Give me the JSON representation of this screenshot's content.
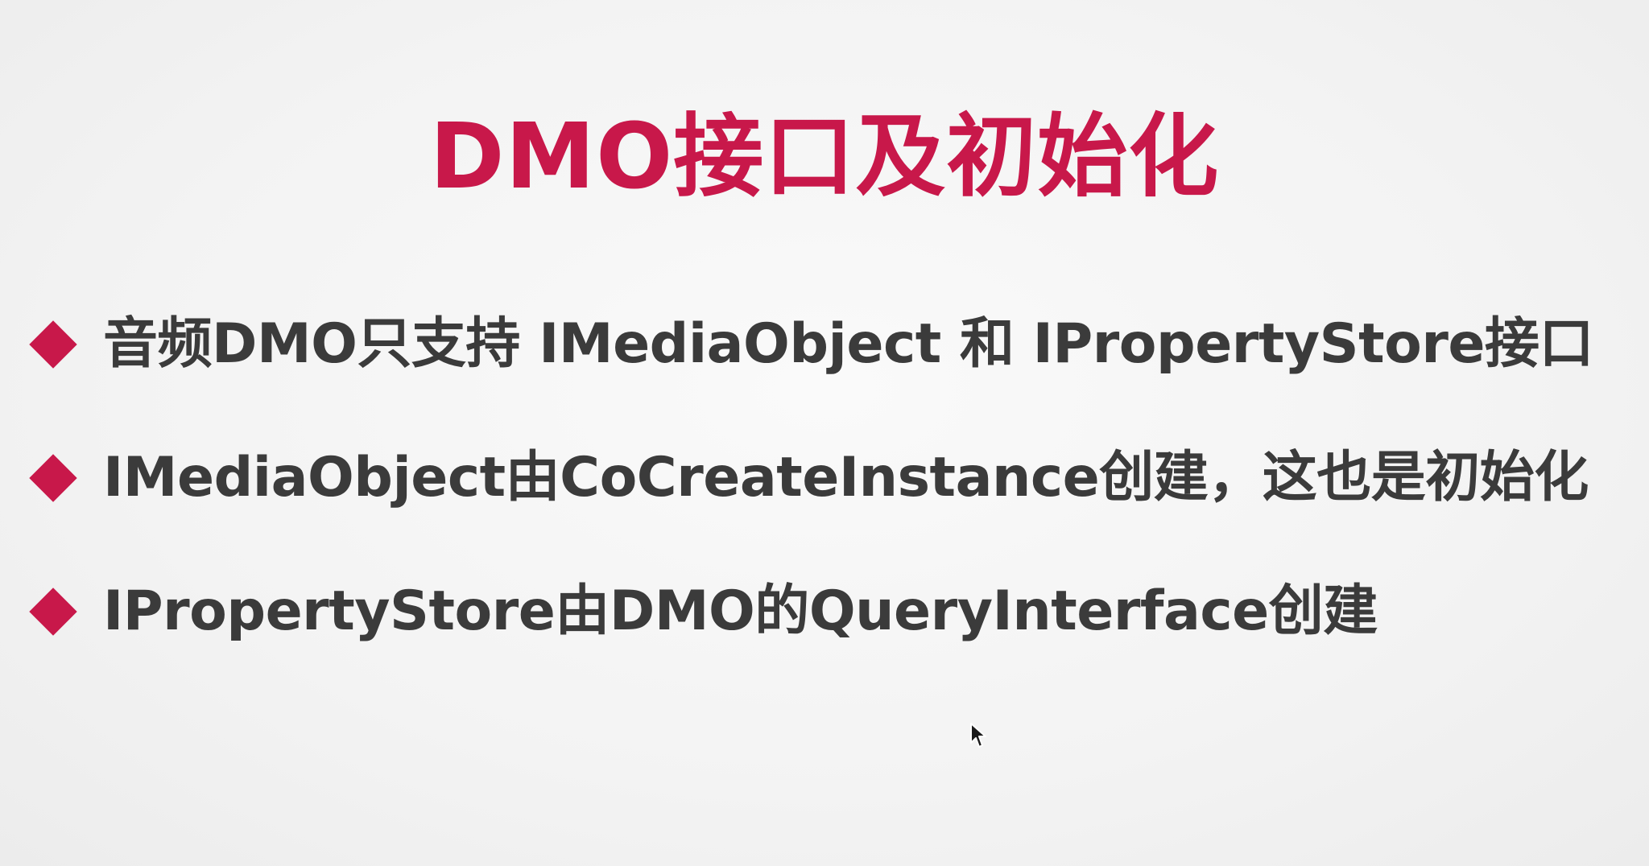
{
  "colors": {
    "accent": "#c8184a",
    "text": "#3b3b3b",
    "background": "#f4f4f4"
  },
  "slide": {
    "title": "DMO接口及初始化",
    "bullets": [
      {
        "text": "音频DMO只支持 IMediaObject 和 IPropertyStore接口"
      },
      {
        "text": "IMediaObject由CoCreateInstance创建，这也是初始化"
      },
      {
        "text": "IPropertyStore由DMO的QueryInterface创建"
      }
    ]
  },
  "cursor": {
    "icon": "mouse-pointer-icon"
  }
}
